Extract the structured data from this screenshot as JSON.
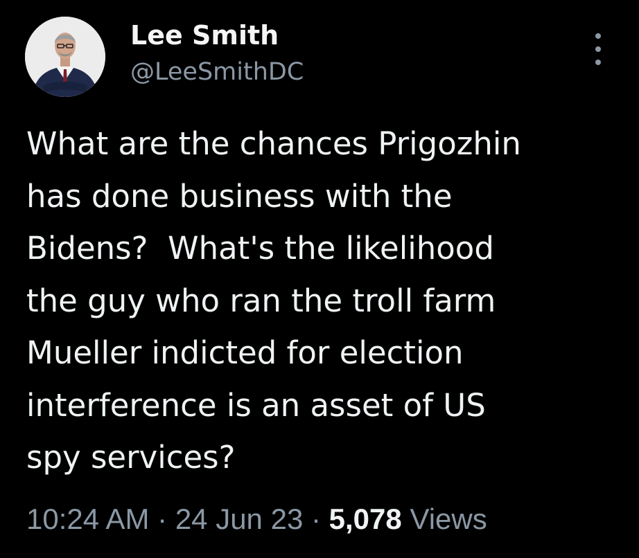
{
  "tweet": {
    "author": {
      "display_name": "Lee Smith",
      "handle": "@LeeSmithDC",
      "avatar": "profile-photo"
    },
    "more_icon": "more-vertical-icon",
    "text": "What are the chances Prigozhin\nhas done business with the\nBidens?  What's the likelihood\nthe guy who ran the troll farm\nMueller indicted for election\ninterference is an asset of US\nspy services?",
    "time": "10:24 AM",
    "separator": "·",
    "date": "24 Jun 23",
    "views_count": "5,078",
    "views_label": "Views"
  },
  "colors": {
    "background": "#000000",
    "primary_text": "#eff3f4",
    "secondary_text": "#8b98a5"
  }
}
